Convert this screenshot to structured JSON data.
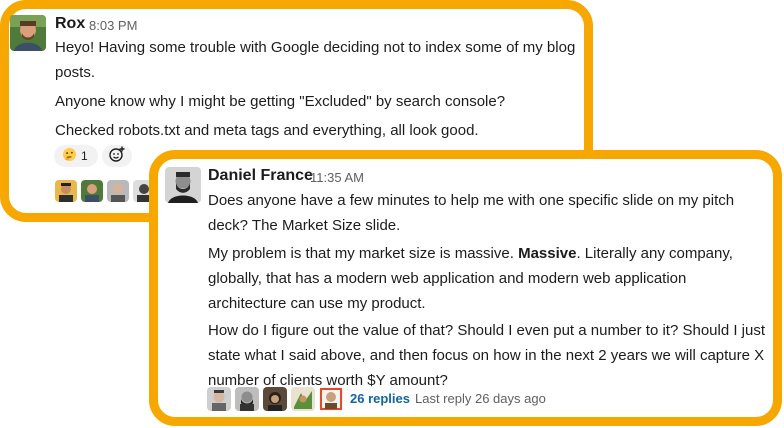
{
  "message1": {
    "author": "Rox",
    "time": "8:03 PM",
    "paragraphs": [
      "Heyo! Having some trouble with Google deciding not to index some of my blog posts.",
      "Anyone know why I might be getting \"Excluded\" by search console?",
      "Checked robots.txt and meta tags and everything, all look good."
    ],
    "reaction": {
      "emoji": "thinking-face",
      "count": "1"
    },
    "add_reaction_icon": "add-emoji-icon",
    "colors": {
      "border": "#f6a800"
    }
  },
  "message2": {
    "author": "Daniel France",
    "time": "11:35 AM",
    "p1": "Does anyone have a few minutes to help me with one specific slide on my pitch deck? The Market Size slide.",
    "p2_before": "My problem is that my market size is massive.  ",
    "p2_bold": "Massive",
    "p2_after": ".  Literally any company, globally, that has a modern web application and modern web application architecture can use my product.",
    "p3": "How do I figure out the value of that? Should I even put a number to it? Should I just state what I said above, and then focus on how in the next 2 years we will capture X number of clients worth $Y amount?",
    "replies": "26 replies",
    "last_reply": "Last reply 26 days ago",
    "colors": {
      "link": "#1264a3"
    }
  }
}
